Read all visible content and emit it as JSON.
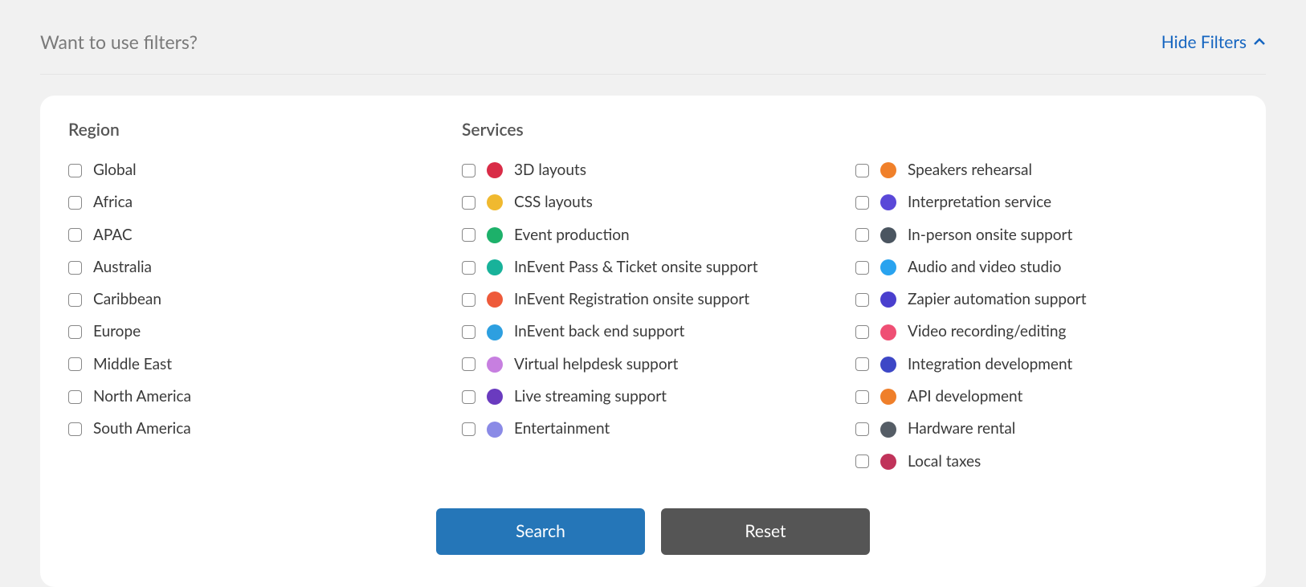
{
  "header": {
    "title": "Want to use filters?",
    "toggle_label": "Hide Filters"
  },
  "region": {
    "title": "Region",
    "items": [
      {
        "label": "Global"
      },
      {
        "label": "Africa"
      },
      {
        "label": "APAC"
      },
      {
        "label": "Australia"
      },
      {
        "label": "Caribbean"
      },
      {
        "label": "Europe"
      },
      {
        "label": "Middle East"
      },
      {
        "label": "North America"
      },
      {
        "label": "South America"
      }
    ]
  },
  "services": {
    "title": "Services",
    "col_a": [
      {
        "label": "3D layouts",
        "color": "#d92c47"
      },
      {
        "label": "CSS layouts",
        "color": "#f0b92f"
      },
      {
        "label": "Event production",
        "color": "#1db16a"
      },
      {
        "label": "InEvent Pass & Ticket onsite support",
        "color": "#18b29a"
      },
      {
        "label": "InEvent Registration onsite support",
        "color": "#ee5a3a"
      },
      {
        "label": "InEvent back end support",
        "color": "#2d9fe0"
      },
      {
        "label": "Virtual helpdesk support",
        "color": "#c77fe0"
      },
      {
        "label": "Live streaming support",
        "color": "#6a3bbf"
      },
      {
        "label": "Entertainment",
        "color": "#8a8ae6"
      }
    ],
    "col_b": [
      {
        "label": "Speakers rehearsal",
        "color": "#f0802a"
      },
      {
        "label": "Interpretation service",
        "color": "#5a48d8"
      },
      {
        "label": "In-person onsite support",
        "color": "#4a5560"
      },
      {
        "label": "Audio and video studio",
        "color": "#29a3ef"
      },
      {
        "label": "Zapier automation support",
        "color": "#4a3fce"
      },
      {
        "label": "Video recording/editing",
        "color": "#ef4f74"
      },
      {
        "label": "Integration development",
        "color": "#3d47c6"
      },
      {
        "label": "API development",
        "color": "#ef7f2a"
      },
      {
        "label": "Hardware rental",
        "color": "#555d66"
      },
      {
        "label": "Local taxes",
        "color": "#c0335a"
      }
    ]
  },
  "buttons": {
    "search": "Search",
    "reset": "Reset"
  }
}
